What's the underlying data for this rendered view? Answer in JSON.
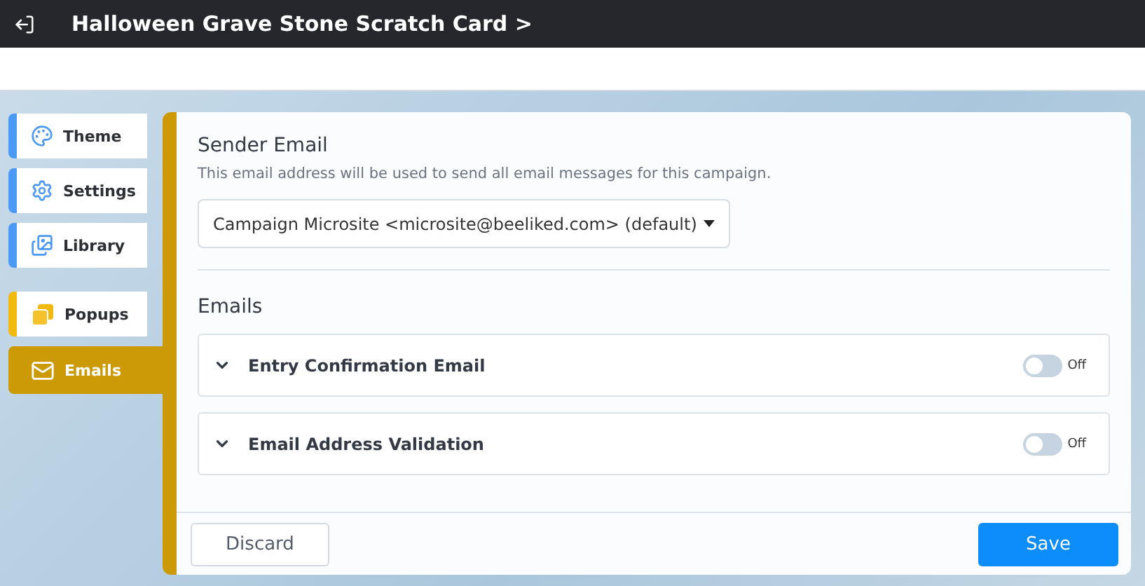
{
  "header": {
    "title": "Halloween Grave Stone Scratch Card >"
  },
  "sidebar": {
    "items": [
      {
        "label": "Theme",
        "color": "#4a9af5",
        "selected": false
      },
      {
        "label": "Settings",
        "color": "#4a9af5",
        "selected": false
      },
      {
        "label": "Library",
        "color": "#4a9af5",
        "selected": false
      },
      {
        "label": "Popups",
        "color": "#f2b90f",
        "selected": false
      },
      {
        "label": "Emails",
        "color": "#cc9a06",
        "selected": true
      }
    ]
  },
  "sender": {
    "title": "Sender Email",
    "description": "This email address will be used to send all email messages for this campaign.",
    "value": "Campaign Microsite <microsite@beeliked.com> (default)"
  },
  "emails": {
    "title": "Emails",
    "items": [
      {
        "label": "Entry Confirmation Email",
        "on": false,
        "state_label": "Off"
      },
      {
        "label": "Email Address Validation",
        "on": false,
        "state_label": "Off"
      }
    ]
  },
  "footer": {
    "discard": "Discard",
    "save": "Save"
  }
}
